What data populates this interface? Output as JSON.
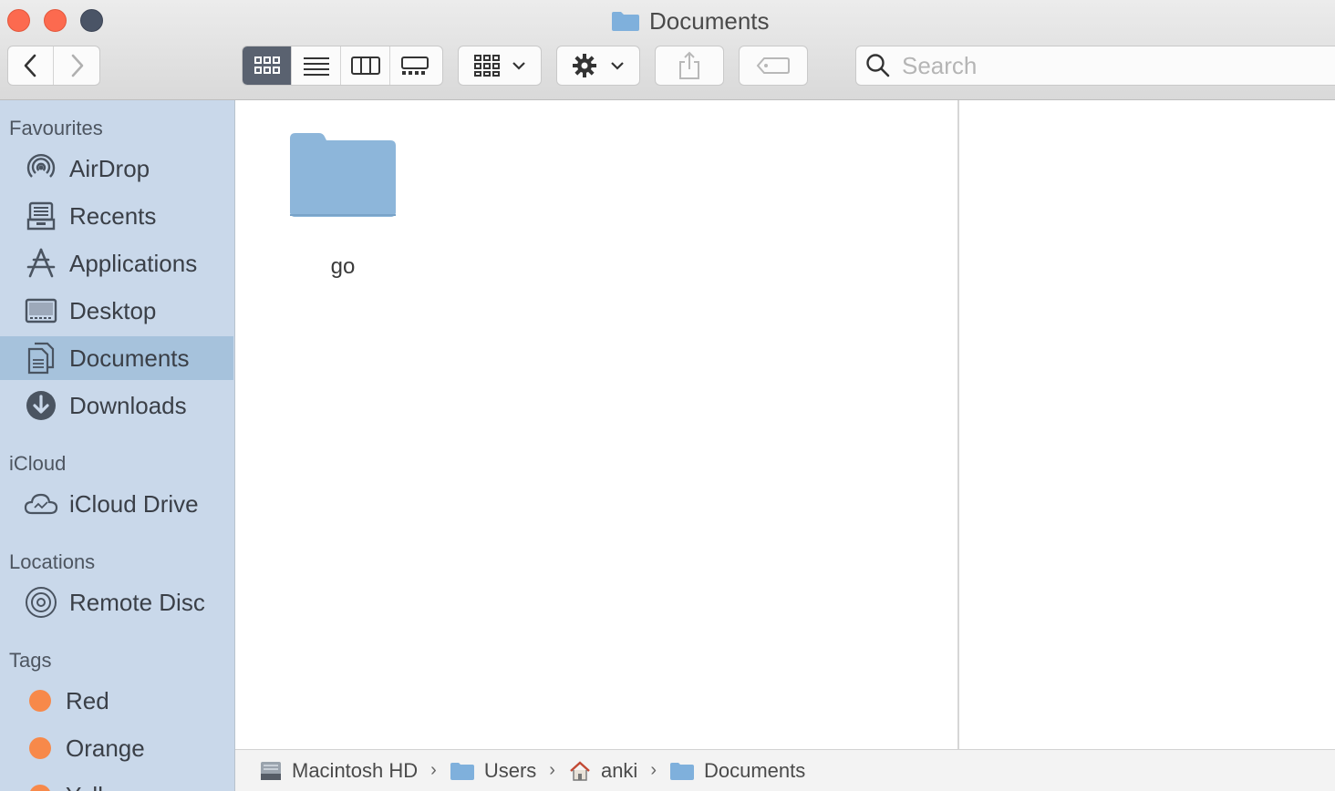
{
  "window": {
    "title": "Documents"
  },
  "toolbar": {
    "search_placeholder": "Search"
  },
  "sidebar": {
    "favourites_heading": "Favourites",
    "favourites": [
      {
        "label": "AirDrop",
        "icon": "airdrop-icon"
      },
      {
        "label": "Recents",
        "icon": "recents-icon"
      },
      {
        "label": "Applications",
        "icon": "applications-icon"
      },
      {
        "label": "Desktop",
        "icon": "desktop-icon"
      },
      {
        "label": "Documents",
        "icon": "documents-icon",
        "selected": true
      },
      {
        "label": "Downloads",
        "icon": "downloads-icon"
      }
    ],
    "icloud_heading": "iCloud",
    "icloud": [
      {
        "label": "iCloud Drive",
        "icon": "icloud-icon"
      }
    ],
    "locations_heading": "Locations",
    "locations": [
      {
        "label": "Remote Disc",
        "icon": "disc-icon"
      }
    ],
    "tags_heading": "Tags",
    "tags": [
      {
        "label": "Red",
        "color": "#f7894a"
      },
      {
        "label": "Orange",
        "color": "#f7894a"
      },
      {
        "label": "Yellow",
        "color": "#f7894a"
      }
    ]
  },
  "content": {
    "items": [
      {
        "name": "go",
        "kind": "folder",
        "color": "#8db6da"
      }
    ]
  },
  "pathbar": {
    "crumbs": [
      "Macintosh HD",
      "Users",
      "anki",
      "Documents"
    ]
  }
}
